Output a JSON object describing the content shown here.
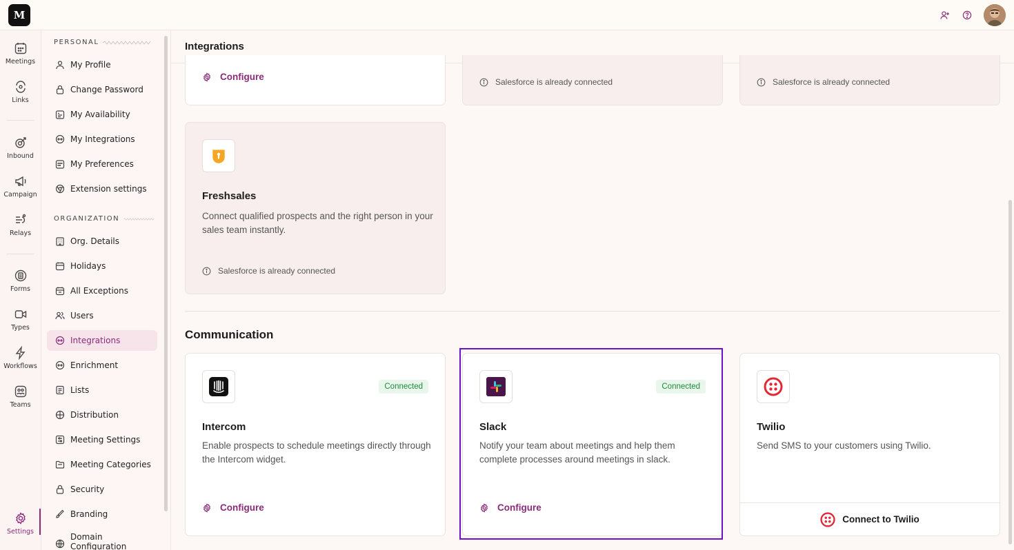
{
  "app": {
    "logo_text": "M"
  },
  "rail": {
    "items": [
      {
        "label": "Meetings",
        "icon": "calendar-icon"
      },
      {
        "label": "Links",
        "icon": "link-icon"
      },
      {
        "label": "Inbound",
        "icon": "inbound-icon"
      },
      {
        "label": "Campaign",
        "icon": "megaphone-icon"
      },
      {
        "label": "Relays",
        "icon": "relay-icon"
      },
      {
        "label": "Forms",
        "icon": "form-icon"
      },
      {
        "label": "Types",
        "icon": "video-icon"
      },
      {
        "label": "Workflows",
        "icon": "lightning-icon"
      },
      {
        "label": "Teams",
        "icon": "team-icon"
      },
      {
        "label": "Settings",
        "icon": "gear-icon"
      }
    ]
  },
  "subnav": {
    "personal_heading": "PERSONAL",
    "organization_heading": "ORGANIZATION",
    "personal": [
      {
        "label": "My Profile"
      },
      {
        "label": "Change Password"
      },
      {
        "label": "My Availability"
      },
      {
        "label": "My Integrations"
      },
      {
        "label": "My Preferences"
      },
      {
        "label": "Extension settings"
      }
    ],
    "organization": [
      {
        "label": "Org. Details"
      },
      {
        "label": "Holidays"
      },
      {
        "label": "All Exceptions"
      },
      {
        "label": "Users"
      },
      {
        "label": "Integrations"
      },
      {
        "label": "Enrichment"
      },
      {
        "label": "Lists"
      },
      {
        "label": "Distribution"
      },
      {
        "label": "Meeting Settings"
      },
      {
        "label": "Meeting Categories"
      },
      {
        "label": "Security"
      },
      {
        "label": "Branding"
      },
      {
        "label": "Domain Configuration"
      }
    ]
  },
  "main": {
    "title": "Integrations",
    "top_row": {
      "configure_label": "Configure",
      "note_1": "Salesforce is already connected",
      "note_2": "Salesforce is already connected"
    },
    "freshsales": {
      "title": "Freshsales",
      "desc": "Connect qualified prospects and the right person in your sales team instantly.",
      "note": "Salesforce is already connected"
    },
    "communication_title": "Communication",
    "intercom": {
      "title": "Intercom",
      "desc": "Enable prospects to schedule meetings directly through the Intercom widget.",
      "badge": "Connected",
      "configure_label": "Configure"
    },
    "slack": {
      "title": "Slack",
      "desc": "Notify your team about meetings and help them complete processes around meetings in slack.",
      "badge": "Connected",
      "configure_label": "Configure"
    },
    "twilio": {
      "title": "Twilio",
      "desc": "Send SMS to your customers using Twilio.",
      "connect_label": "Connect to Twilio"
    }
  },
  "colors": {
    "accent": "#8b2b79",
    "connected_bg": "#e9f6ec",
    "connected_text": "#1e8a3a",
    "highlight": "#6a12c9"
  }
}
